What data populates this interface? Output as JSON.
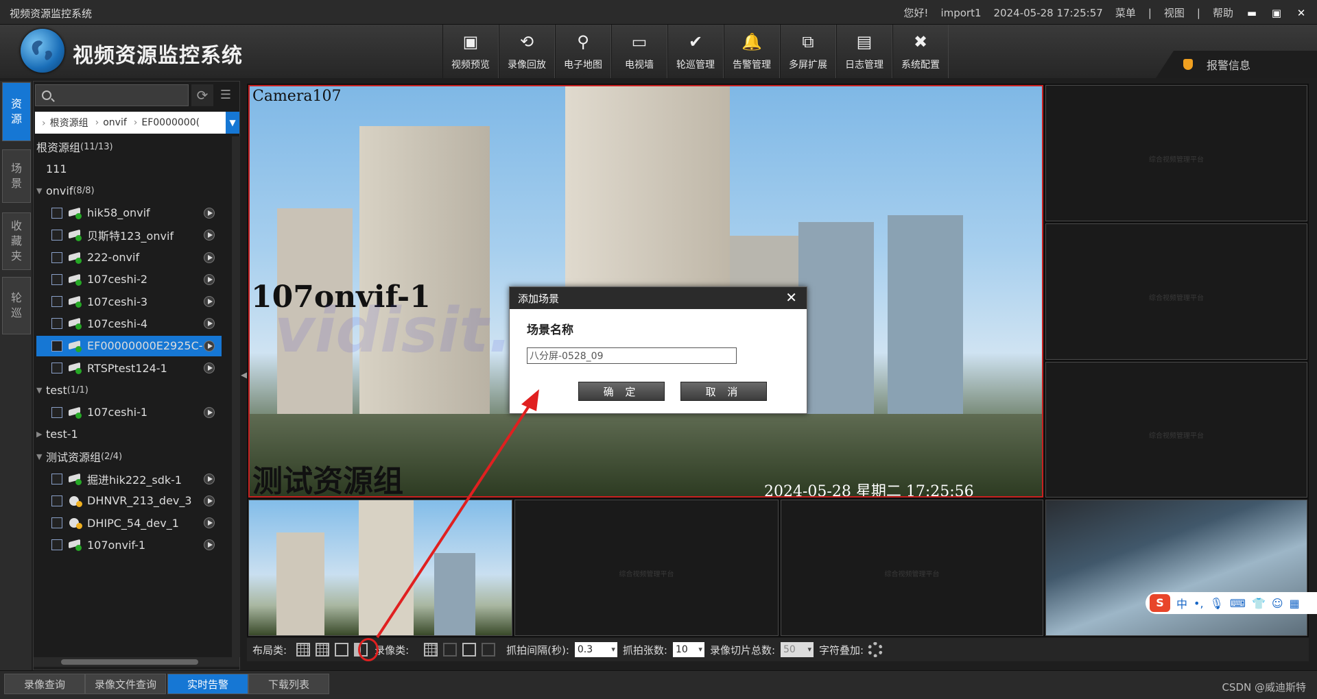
{
  "titlebar": {
    "title": "视频资源监控系统",
    "greeting": "您好!",
    "user": "import1",
    "datetime": "2024-05-28 17:25:57",
    "menu": "菜单",
    "view": "视图",
    "help": "帮助",
    "sep": "|"
  },
  "header": {
    "app_name": "视频资源监控系统",
    "nav": [
      {
        "label": "视频预览",
        "icon": "video-camera-icon"
      },
      {
        "label": "录像回放",
        "icon": "playback-icon"
      },
      {
        "label": "电子地图",
        "icon": "map-pin-icon"
      },
      {
        "label": "电视墙",
        "icon": "tv-wall-icon"
      },
      {
        "label": "轮巡管理",
        "icon": "patrol-check-icon"
      },
      {
        "label": "告警管理",
        "icon": "bell-icon"
      },
      {
        "label": "多屏扩展",
        "icon": "multi-screen-icon"
      },
      {
        "label": "日志管理",
        "icon": "log-book-icon"
      },
      {
        "label": "系统配置",
        "icon": "tools-icon"
      }
    ],
    "alarm_info": "报警信息"
  },
  "side_tabs": [
    "资源",
    "场景",
    "收藏夹",
    "轮巡"
  ],
  "tree": {
    "breadcrumb": [
      "根资源组",
      "onvif",
      "EF0000000("
    ],
    "root": {
      "label": "根资源组",
      "count": "(11/13)"
    },
    "items": [
      {
        "type": "leaf-plain",
        "label": "111"
      },
      {
        "type": "group",
        "label": "onvif",
        "count": "(8/8)"
      },
      {
        "type": "cam",
        "label": "hik58_onvif"
      },
      {
        "type": "cam",
        "label": "贝斯特123_onvif"
      },
      {
        "type": "cam",
        "label": "222-onvif"
      },
      {
        "type": "cam",
        "label": "107ceshi-2"
      },
      {
        "type": "cam",
        "label": "107ceshi-3"
      },
      {
        "type": "cam",
        "label": "107ceshi-4"
      },
      {
        "type": "cam",
        "label": "EF00000000E2925C-",
        "selected": true
      },
      {
        "type": "cam",
        "label": "RTSPtest124-1"
      },
      {
        "type": "group",
        "label": "test",
        "count": "(1/1)"
      },
      {
        "type": "cam",
        "label": "107ceshi-1"
      },
      {
        "type": "group-closed",
        "label": "test-1"
      },
      {
        "type": "group",
        "label": "测试资源组",
        "count": "(2/4)"
      },
      {
        "type": "cam",
        "label": "掘进hik222_sdk-1"
      },
      {
        "type": "dh",
        "label": "DHNVR_213_dev_3"
      },
      {
        "type": "dh",
        "label": "DHIPC_54_dev_1"
      },
      {
        "type": "cam",
        "label": "107onvif-1"
      }
    ]
  },
  "video": {
    "main_osd_camera": "Camera107",
    "main_osd_name": "107onvif-1",
    "main_osd_group": "测试资源组",
    "main_osd_time": "2024-05-28  星期二  17:25:56",
    "empty_watermark": "综合视频管理平台"
  },
  "dialog": {
    "title": "添加场景",
    "field_label": "场景名称",
    "field_value": "八分屏-0528_09",
    "ok": "确  定",
    "cancel": "取  消"
  },
  "toolbar": {
    "layout_label": "布局类:",
    "record_label": "录像类:",
    "interval_label": "抓拍间隔(秒):",
    "interval_value": "0.3",
    "count_label": "抓拍张数:",
    "count_value": "10",
    "slices_label": "录像切片总数:",
    "slices_value": "50",
    "overlay_label": "字符叠加:"
  },
  "bottom_tabs": [
    {
      "label": "录像查询",
      "active": false
    },
    {
      "label": "录像文件查询",
      "active": false
    },
    {
      "label": "实时告警",
      "active": true
    },
    {
      "label": "下载列表",
      "active": false
    }
  ],
  "credit": "CSDN @威迪斯特",
  "watermark": "vidisit.cn",
  "ime": {
    "brand": "S",
    "lang": "中",
    "punct": "•,"
  }
}
